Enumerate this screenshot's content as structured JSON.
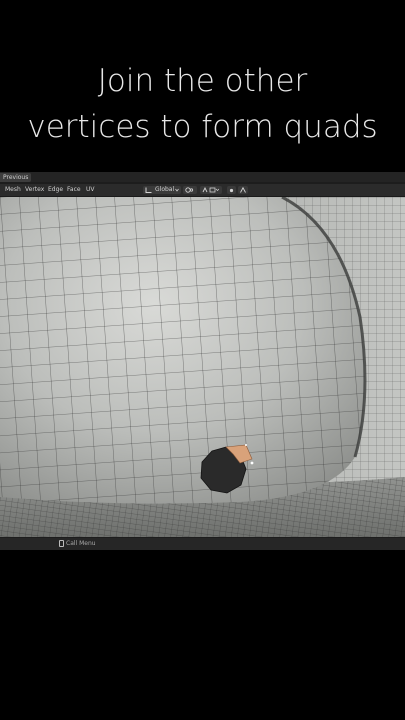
{
  "caption": {
    "line1": "Join the other",
    "line2": "vertices to form quads"
  },
  "toolbar": {
    "previous_label": "Previous"
  },
  "menu": {
    "items": [
      "Mesh",
      "Vertex",
      "Edge",
      "Face",
      "UV"
    ]
  },
  "transform_orientation": {
    "value": "Global"
  },
  "status_bar": {
    "call_menu": "Call Menu"
  },
  "colors": {
    "mesh_surface": "#b9bbb8",
    "mesh_highlight": "#d6d7d4",
    "mesh_wire": "#2e2e2e",
    "hole": "#2a2a2a",
    "selected_face": "#d9a27a"
  },
  "icons": {
    "orientation": "transform-orientation-icon",
    "pivot": "pivot-point-icon",
    "snap": "snap-icon",
    "proportional": "proportional-editing-icon",
    "falloff": "falloff-icon",
    "status": "document-icon"
  }
}
